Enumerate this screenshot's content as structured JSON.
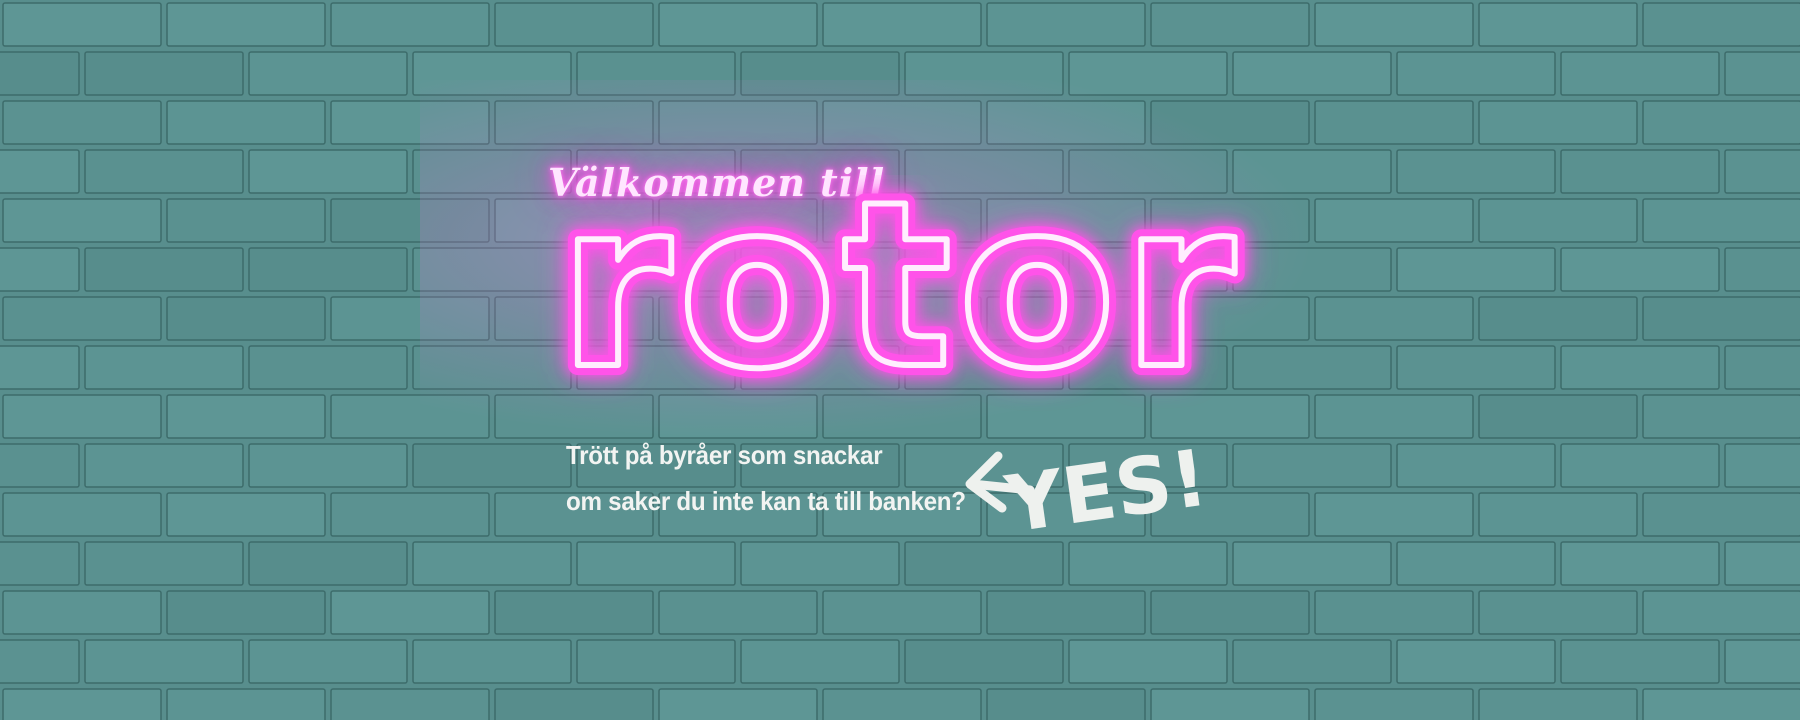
{
  "hero": {
    "welcome": "Välkommen till",
    "brand": "rotor",
    "tagline_line1": "Trött på byråer som snackar",
    "tagline_line2": "om saker du inte kan ta till banken?",
    "scribble": "YES!"
  },
  "colors": {
    "wall": "#588e8d",
    "mortar": "#3d6c6b",
    "neon_pink": "#ff4fe8",
    "neon_core": "#ffeefe",
    "text": "#f2f4f2"
  },
  "icons": [
    "left-arrow-icon"
  ]
}
